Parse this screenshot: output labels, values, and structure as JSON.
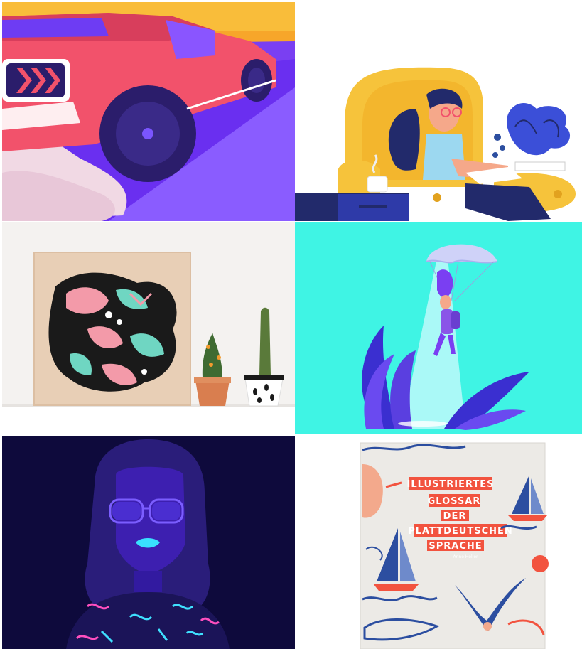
{
  "gallery": {
    "tiles": [
      {
        "id": "muscle-car",
        "subject": "pink muscle car illustration"
      },
      {
        "id": "woman-armchair",
        "subject": "woman reading in yellow armchair"
      },
      {
        "id": "art-board-cacti",
        "subject": "painted wooden board with cacti"
      },
      {
        "id": "parachute-girl",
        "subject": "girl descending with parachute"
      },
      {
        "id": "neon-portrait",
        "subject": "neon portrait with glasses"
      },
      {
        "id": "book-cover",
        "subject": "illustrated book cover"
      }
    ],
    "book": {
      "title_lines": [
        "ILLUSTRIERTES",
        "GLOSSAR",
        "DER",
        "PLATTDEUTSCHEN",
        "SPRACHE"
      ],
      "author": "Anne Heller"
    }
  },
  "colors": {
    "car_red": "#f2526b",
    "road_purple": "#6a2ff0",
    "sky_orange": "#f7a62a",
    "chair_yellow": "#f6c33b",
    "navy": "#222a6b",
    "aqua": "#3ff4e4",
    "neon_bg": "#0e0a3c",
    "book_red": "#f2533f",
    "book_blue": "#2c4ea0"
  }
}
